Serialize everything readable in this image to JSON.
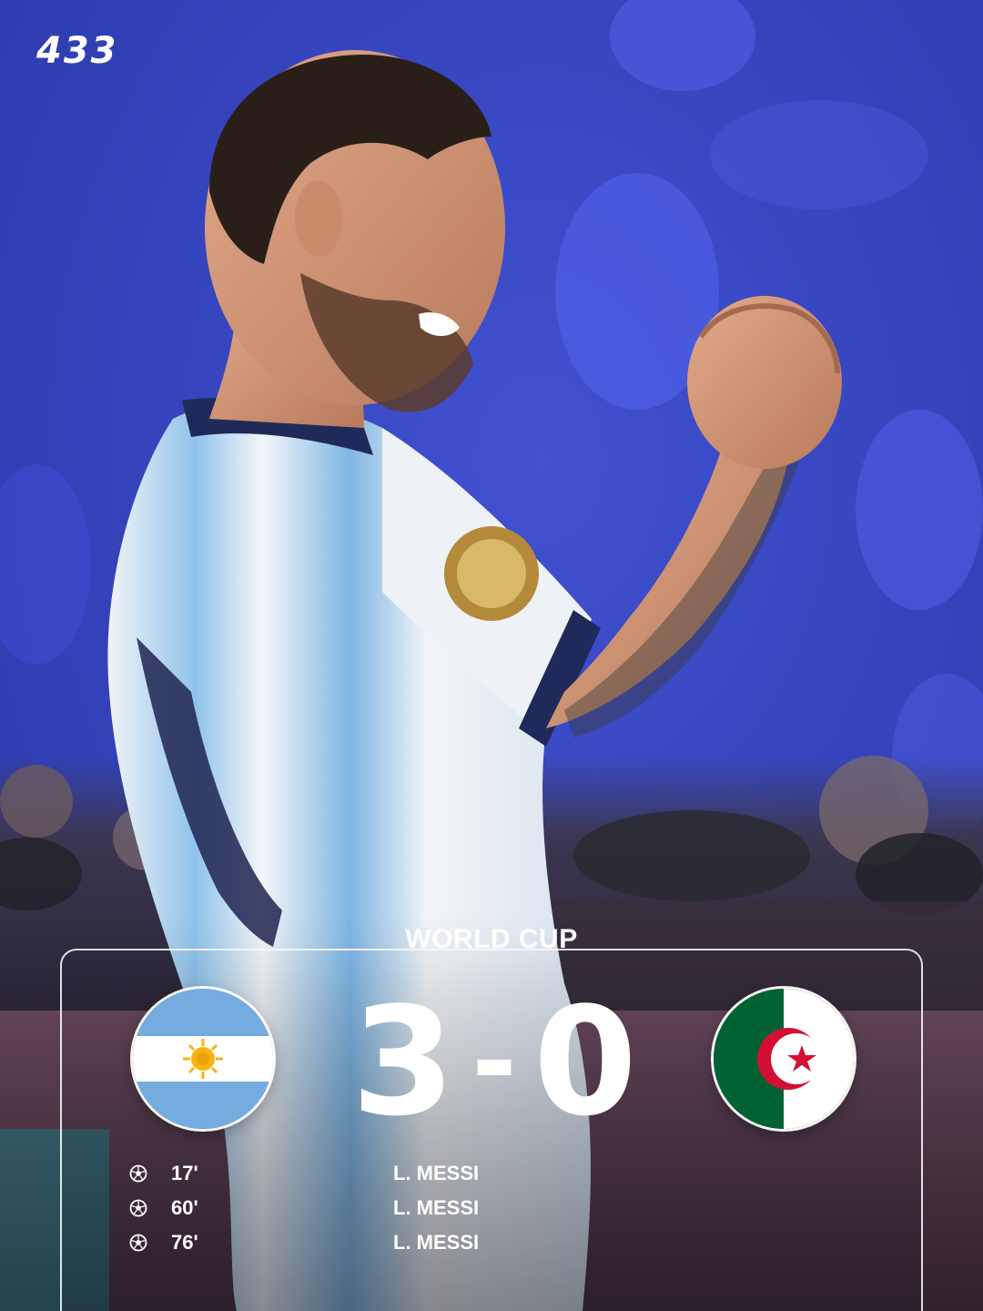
{
  "brand": {
    "logo_text": "433"
  },
  "match": {
    "competition": "WORLD CUP",
    "home": {
      "team": "Argentina",
      "score": "3",
      "flag_icon": "argentina-flag-icon"
    },
    "away": {
      "team": "Algeria",
      "score": "0",
      "flag_icon": "algeria-flag-icon"
    },
    "separator": "-"
  },
  "goals": [
    {
      "icon": "football-icon",
      "minute": "17'",
      "scorer": "L. MESSI"
    },
    {
      "icon": "football-icon",
      "minute": "60'",
      "scorer": "L. MESSI"
    },
    {
      "icon": "football-icon",
      "minute": "76'",
      "scorer": "L. MESSI"
    }
  ],
  "colors": {
    "background_blue": "#2f3fbf",
    "argentina_sky": "#74acdf",
    "algeria_green": "#006233",
    "algeria_red": "#d21034"
  }
}
